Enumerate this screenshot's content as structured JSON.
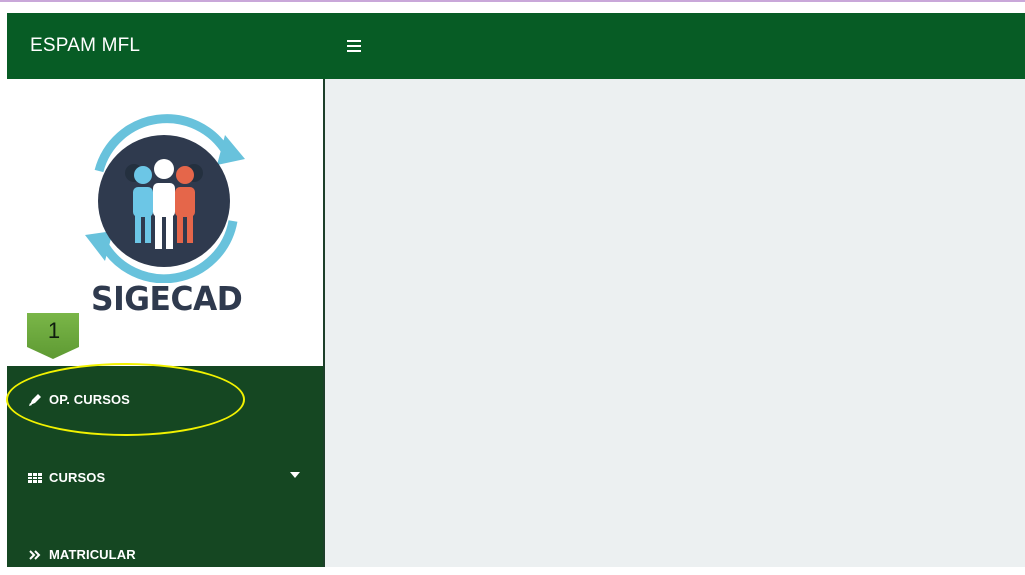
{
  "header": {
    "brand": "ESPAM MFL",
    "menu_icon": "hamburger-icon",
    "bg_color": "#075c25"
  },
  "sidebar": {
    "logo_text": "SIGECAD",
    "items": [
      {
        "label": "OP. CURSOS",
        "icon": "pencil-icon"
      },
      {
        "label": "CURSOS",
        "icon": "table-icon",
        "has_dropdown": true
      },
      {
        "label": "MATRICULAR",
        "icon": "double-chevron-icon"
      }
    ],
    "bg_color": "#154722"
  },
  "annotation": {
    "step_number": "1",
    "callout_color": "#6ea53f",
    "highlight_color": "#f2f200"
  }
}
